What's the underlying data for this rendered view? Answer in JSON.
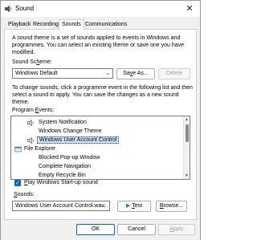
{
  "window": {
    "title": "Sound",
    "close_glyph": "✕"
  },
  "tabs": [
    {
      "label": "Playback",
      "active": false
    },
    {
      "label": "Recording",
      "active": false
    },
    {
      "label": "Sounds",
      "active": true
    },
    {
      "label": "Communications",
      "active": false
    }
  ],
  "intro_text": "A sound theme is a set of sounds applied to events in Windows and programmes. You can select an existing theme or save one you have modified.",
  "scheme": {
    "label_prefix": "Sound Sc",
    "label_accel": "h",
    "label_suffix": "eme:",
    "value": "Windows Default",
    "save_as_prefix": "Sa",
    "save_as_accel": "v",
    "save_as_suffix": "e As...",
    "delete_label": "Delete"
  },
  "instructions_text": "To change sounds, click a programme event in the following list and then select a sound to apply. You can save the changes as a new sound theme.",
  "events": {
    "label_prefix": "Program ",
    "label_accel": "E",
    "label_suffix": "vents:",
    "items": [
      {
        "label": "System Notification",
        "level": 2,
        "icon": "speaker-icon",
        "selected": false
      },
      {
        "label": "Windows Change Theme",
        "level": 2,
        "icon": "none",
        "selected": false
      },
      {
        "label": "Windows User Account Control",
        "level": 2,
        "icon": "speaker-icon",
        "selected": true
      },
      {
        "label": "File Explorer",
        "level": 1,
        "icon": "explorer-icon",
        "selected": false
      },
      {
        "label": "Blocked Pop-up Window",
        "level": 2,
        "icon": "none",
        "selected": false
      },
      {
        "label": "Complete Navigation",
        "level": 2,
        "icon": "none",
        "selected": false
      },
      {
        "label": "Empty Recycle Bin",
        "level": 2,
        "icon": "none",
        "selected": false
      }
    ]
  },
  "startup": {
    "checked": true,
    "check_glyph": "✓",
    "label_accel": "P",
    "label_suffix": "lay Windows Start-up sound"
  },
  "sounds": {
    "label_prefix": "",
    "label_accel": "S",
    "label_suffix": "ounds:",
    "value": "Windows User Account Control.wav",
    "test_accel": "T",
    "test_suffix": "est",
    "browse_accel": "B",
    "browse_suffix": "rowse..."
  },
  "footer": {
    "ok": "OK",
    "cancel": "Cancel",
    "apply_accel": "A",
    "apply_suffix": "pply"
  },
  "colors": {
    "accent": "#0067c0",
    "selection": "#cce4f7",
    "play": "#1a9e3a"
  }
}
